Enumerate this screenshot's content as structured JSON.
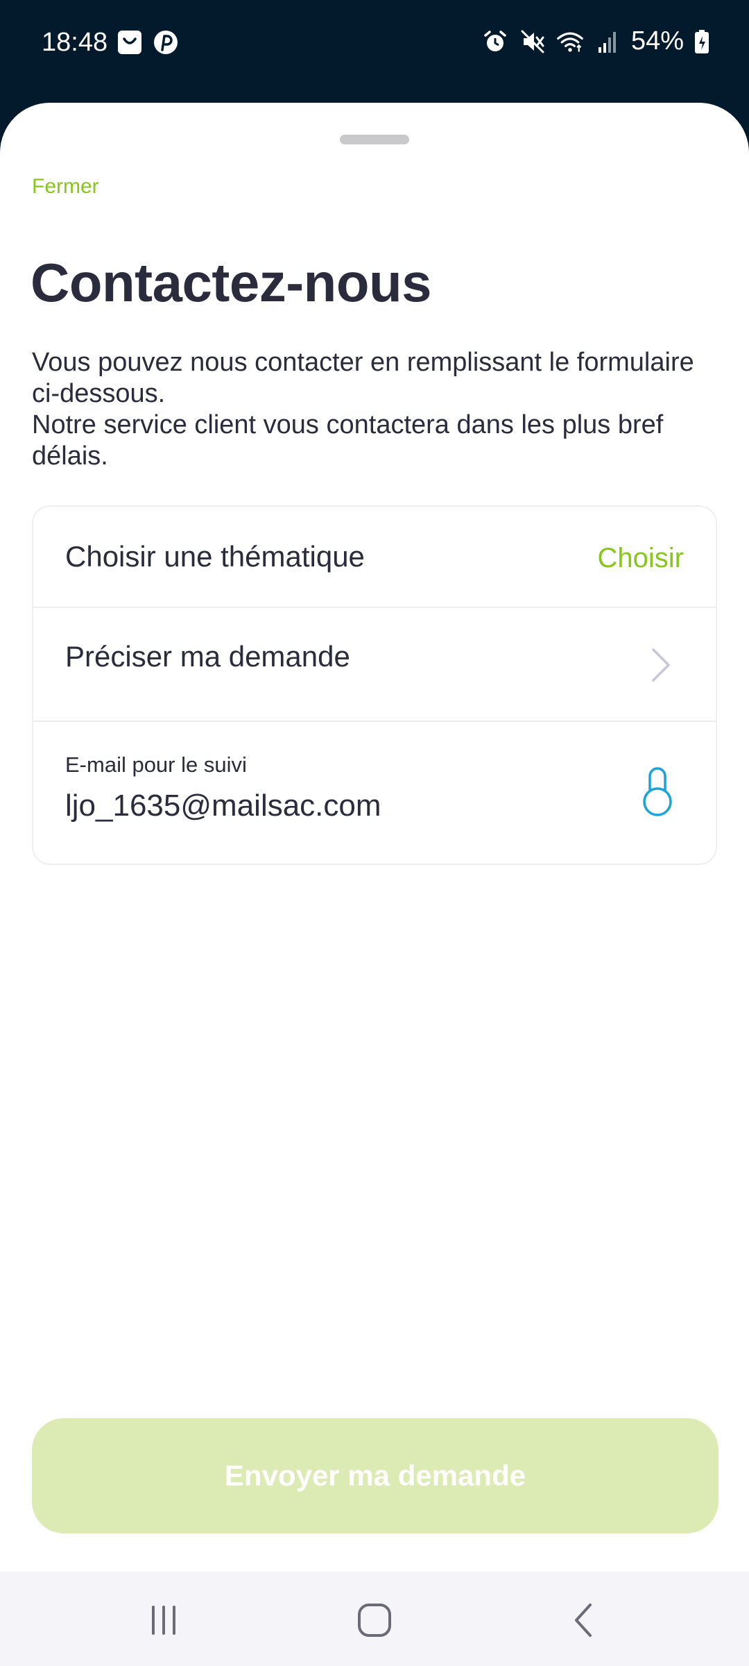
{
  "status_bar": {
    "time": "18:48",
    "battery": "54%",
    "notification_icons": [
      "shopping-bag-icon",
      "pinterest-icon"
    ],
    "system_icons": [
      "alarm-icon",
      "mute-icon",
      "wifi-icon",
      "signal-icon",
      "battery-icon"
    ]
  },
  "sheet": {
    "close_label": "Fermer",
    "title": "Contactez-nous",
    "description_line1": "Vous pouvez nous contacter en remplissant le formulaire ci-dessous.",
    "description_line2": "Notre service client vous contactera dans les plus bref délais."
  },
  "form": {
    "theme_label": "Choisir une thématique",
    "theme_value": "Choisir",
    "request_label": "Préciser ma demande",
    "email_label": "E-mail pour le suivi",
    "email_value": "ljo_1635@mailsac.com"
  },
  "submit_label": "Envoyer ma demande",
  "colors": {
    "accent": "#86c81a",
    "text": "#2a2b3d",
    "button_disabled": "#dbebb3",
    "status_bar": "#021a2c",
    "lock_icon": "#1aa3d9"
  }
}
